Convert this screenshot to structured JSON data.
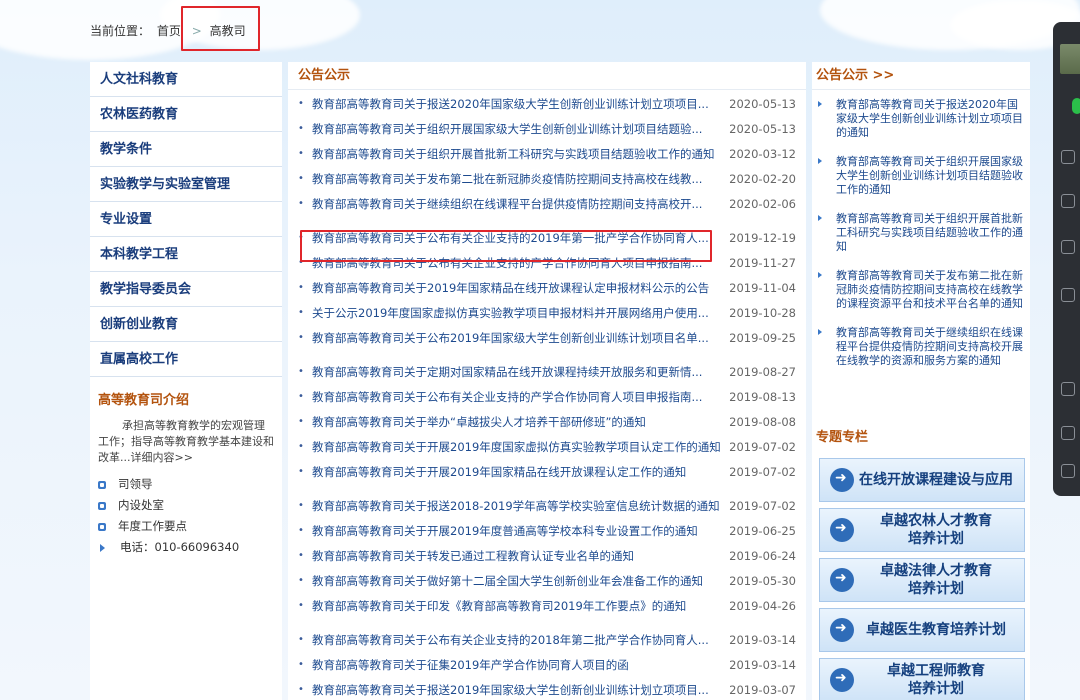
{
  "breadcrumb": {
    "label": "当前位置：",
    "home": "首页",
    "sep": ">",
    "current": "高教司"
  },
  "left_nav": [
    "人文社科教育",
    "农林医药教育",
    "教学条件",
    "实验教学与实验室管理",
    "专业设置",
    "本科教学工程",
    "教学指导委员会",
    "创新创业教育",
    "直属高校工作"
  ],
  "intro": {
    "title": "高等教育司介绍",
    "text": "承担高等教育教学的宏观管理工作；指导高等教育教学基本建设和改革...详细内容>>",
    "items": [
      "司领导",
      "内设处室",
      "年度工作要点"
    ],
    "phone": "电话：010-66096340"
  },
  "notice": {
    "title": "公告公示",
    "items": [
      {
        "title": "教育部高等教育司关于报送2020年国家级大学生创新创业训练计划立项项目...",
        "date": "2020-05-13"
      },
      {
        "title": "教育部高等教育司关于组织开展国家级大学生创新创业训练计划项目结题验...",
        "date": "2020-05-13"
      },
      {
        "title": "教育部高等教育司关于组织开展首批新工科研究与实践项目结题验收工作的通知",
        "date": "2020-03-12"
      },
      {
        "title": "教育部高等教育司关于发布第二批在新冠肺炎疫情防控期间支持高校在线教...",
        "date": "2020-02-20"
      },
      {
        "title": "教育部高等教育司关于继续组织在线课程平台提供疫情防控期间支持高校开...",
        "date": "2020-02-06"
      },
      {
        "title": "教育部高等教育司关于公布有关企业支持的2019年第一批产学合作协同育人...",
        "date": "2019-12-19"
      },
      {
        "title": "教育部高等教育司关于公布有关企业支持的产学合作协同育人项目申报指南...",
        "date": "2019-11-27"
      },
      {
        "title": "教育部高等教育司关于2019年国家精品在线开放课程认定申报材料公示的公告",
        "date": "2019-11-04"
      },
      {
        "title": "关于公示2019年度国家虚拟仿真实验教学项目申报材料并开展网络用户使用...",
        "date": "2019-10-28"
      },
      {
        "title": "教育部高等教育司关于公布2019年国家级大学生创新创业训练计划项目名单...",
        "date": "2019-09-25"
      },
      {
        "title": "教育部高等教育司关于定期对国家精品在线开放课程持续开放服务和更新情...",
        "date": "2019-08-27"
      },
      {
        "title": "教育部高等教育司关于公布有关企业支持的产学合作协同育人项目申报指南...",
        "date": "2019-08-13"
      },
      {
        "title": "教育部高等教育司关于举办“卓越拔尖人才培养干部研修班”的通知",
        "date": "2019-08-08"
      },
      {
        "title": "教育部高等教育司关于开展2019年度国家虚拟仿真实验教学项目认定工作的通知",
        "date": "2019-07-02"
      },
      {
        "title": "教育部高等教育司关于开展2019年国家精品在线开放课程认定工作的通知",
        "date": "2019-07-02"
      },
      {
        "title": "教育部高等教育司关于报送2018-2019学年高等学校实验室信息统计数据的通知",
        "date": "2019-07-02"
      },
      {
        "title": "教育部高等教育司关于开展2019年度普通高等学校本科专业设置工作的通知",
        "date": "2019-06-25"
      },
      {
        "title": "教育部高等教育司关于转发已通过工程教育认证专业名单的通知",
        "date": "2019-06-24"
      },
      {
        "title": "教育部高等教育司关于做好第十二届全国大学生创新创业年会准备工作的通知",
        "date": "2019-05-30"
      },
      {
        "title": "教育部高等教育司关于印发《教育部高等教育司2019年工作要点》的通知",
        "date": "2019-04-26"
      },
      {
        "title": "教育部高等教育司关于公布有关企业支持的2018年第二批产学合作协同育人...",
        "date": "2019-03-14"
      },
      {
        "title": "教育部高等教育司关于征集2019年产学合作协同育人项目的函",
        "date": "2019-03-14"
      },
      {
        "title": "教育部高等教育司关于报送2019年国家级大学生创新创业训练计划立项项目...",
        "date": "2019-03-07"
      }
    ]
  },
  "right": {
    "title": "公告公示 >>",
    "items": [
      "教育部高等教育司关于报送2020年国家级大学生创新创业训练计划立项项目的通知",
      "教育部高等教育司关于组织开展国家级大学生创新创业训练计划项目结题验收工作的通知",
      "教育部高等教育司关于组织开展首批新工科研究与实践项目结题验收工作的通知",
      "教育部高等教育司关于发布第二批在新冠肺炎疫情防控期间支持高校在线教学的课程资源平台和技术平台名单的通知",
      "教育部高等教育司关于继续组织在线课程平台提供疫情防控期间支持高校开展在线教学的资源和服务方案的通知"
    ],
    "special_title": "专题专栏",
    "banners": [
      "在线开放课程建设与应用",
      "卓越农林人才教育\n培养计划",
      "卓越法律人才教育\n培养计划",
      "卓越医生教育培养计划",
      "卓越工程师教育\n培养计划"
    ]
  }
}
